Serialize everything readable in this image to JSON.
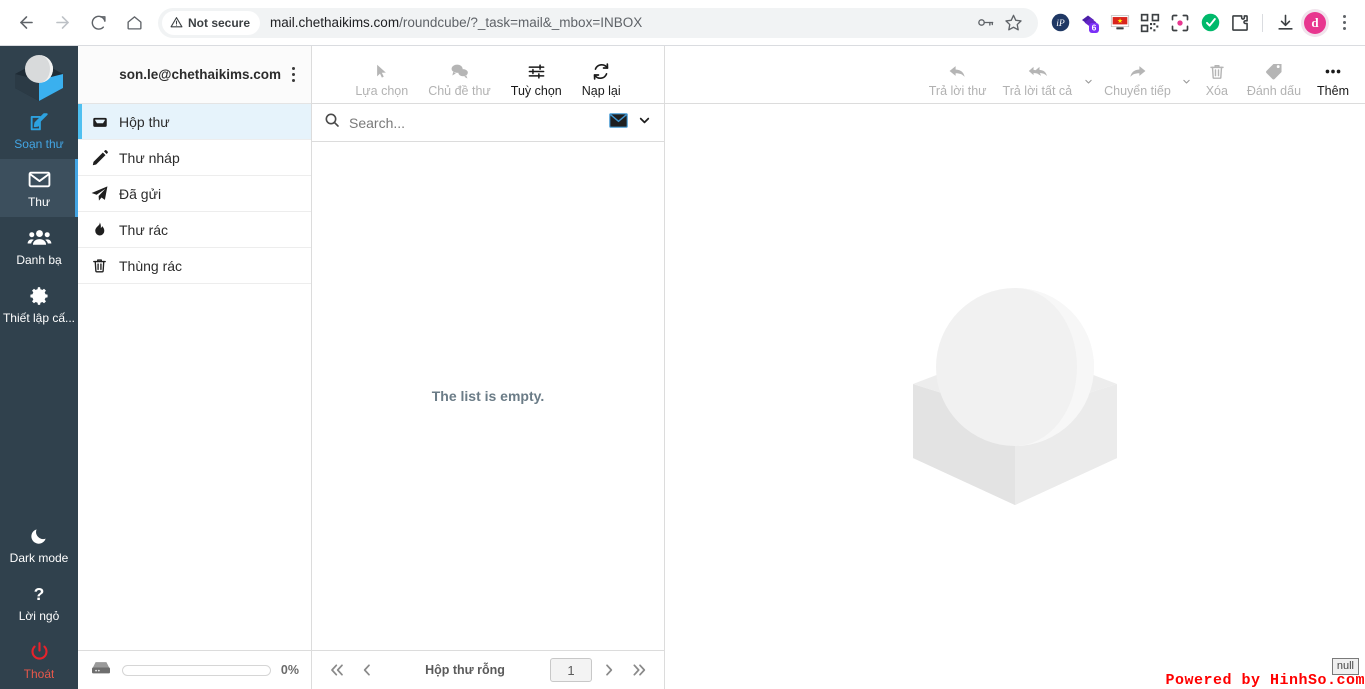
{
  "browser": {
    "back_icon": "arrow-left-icon",
    "forward_icon": "arrow-right-icon",
    "reload_icon": "reload-icon",
    "home_icon": "home-icon",
    "security_label": "Not secure",
    "url_main": "mail.chethaikims.com",
    "url_path": "/roundcube/?_task=mail&_mbox=INBOX",
    "url_full": "mail.chethaikims.com/roundcube/?_task=mail&_mbox=INBOX",
    "password_icon": "key-icon",
    "bookmark_icon": "star-icon",
    "extensions": [
      {
        "name": "ip-extension-icon",
        "badge": "",
        "color": "#1f3864"
      },
      {
        "name": "layers-extension-icon",
        "badge": "6",
        "color": "#6425c7"
      },
      {
        "name": "vietnam-flag-icon",
        "badge": "",
        "color": "#da251d"
      },
      {
        "name": "qr-code-icon",
        "badge": "",
        "color": "#3c4043"
      },
      {
        "name": "screenshot-capture-icon",
        "badge": "",
        "color": "#3c4043"
      },
      {
        "name": "shield-check-icon",
        "badge": "",
        "color": "#00b96b"
      },
      {
        "name": "puzzle-extensions-icon",
        "badge": "",
        "color": "#3c4043"
      }
    ],
    "download_icon": "download-icon",
    "profile_initial": "d",
    "profile_color": "#e8368f",
    "menu_icon": "kebab-menu-icon"
  },
  "rail": {
    "logo_icon": "roundcube-logo-icon",
    "items": [
      {
        "label": "Soạn thư",
        "icon": "compose-icon",
        "state": "accent"
      },
      {
        "label": "Thư",
        "icon": "envelope-icon",
        "state": "selected"
      },
      {
        "label": "Danh bạ",
        "icon": "contacts-icon",
        "state": "normal"
      },
      {
        "label": "Thiết lập cấ...",
        "icon": "gear-icon",
        "state": "normal"
      }
    ],
    "bottom_items": [
      {
        "label": "Dark mode",
        "icon": "moon-icon",
        "state": "normal"
      },
      {
        "label": "Lời ngỏ",
        "icon": "question-icon",
        "state": "normal"
      },
      {
        "label": "Thoát",
        "icon": "power-icon",
        "state": "logout"
      }
    ]
  },
  "folders": {
    "account": "son.le@chethaikims.com",
    "options_icon": "kebab-menu-icon",
    "items": [
      {
        "label": "Hộp thư",
        "icon": "inbox-icon",
        "selected": true
      },
      {
        "label": "Thư nháp",
        "icon": "pencil-icon",
        "selected": false
      },
      {
        "label": "Đã gửi",
        "icon": "paper-plane-icon",
        "selected": false
      },
      {
        "label": "Thư rác",
        "icon": "fire-icon",
        "selected": false
      },
      {
        "label": "Thùng rác",
        "icon": "trash-icon",
        "selected": false
      }
    ],
    "quota_icon": "disk-icon",
    "quota_percent": "0%",
    "quota_value": 0
  },
  "list_toolbar": {
    "buttons": [
      {
        "label": "Lựa chọn",
        "icon": "cursor-select-icon",
        "disabled": true
      },
      {
        "label": "Chủ đề thư",
        "icon": "threads-icon",
        "disabled": true
      },
      {
        "label": "Tuỳ chọn",
        "icon": "sliders-options-icon",
        "disabled": false
      },
      {
        "label": "Nạp lại",
        "icon": "refresh-icon",
        "disabled": false
      }
    ]
  },
  "search": {
    "icon": "search-icon",
    "placeholder": "Search...",
    "value": "",
    "scope_icon": "envelope-icon",
    "dropdown_icon": "chevron-down-icon"
  },
  "message_list": {
    "empty_text": "The list is empty."
  },
  "list_footer": {
    "first_icon": "double-chevron-left-icon",
    "prev_icon": "chevron-left-icon",
    "status": "Hộp thư rỗng",
    "page": "1",
    "next_icon": "chevron-right-icon",
    "last_icon": "double-chevron-right-icon"
  },
  "content_toolbar": {
    "buttons": [
      {
        "label": "Trả lời thư",
        "icon": "reply-icon",
        "disabled": true,
        "caret": false
      },
      {
        "label": "Trả lời tất cả",
        "icon": "reply-all-icon",
        "disabled": true,
        "caret": true
      },
      {
        "label": "Chuyển tiếp",
        "icon": "forward-icon",
        "disabled": true,
        "caret": true
      },
      {
        "label": "Xóa",
        "icon": "trash-icon",
        "disabled": true,
        "caret": false
      },
      {
        "label": "Đánh dấu",
        "icon": "tag-icon",
        "disabled": true,
        "caret": false
      },
      {
        "label": "Thêm",
        "icon": "ellipsis-icon",
        "disabled": false,
        "caret": false
      }
    ]
  },
  "content": {
    "watermark_icon": "roundcube-watermark-icon",
    "powered_by": "Powered by HinhSo.com",
    "tooltip": "null"
  },
  "colors": {
    "rail_bg": "#30414d",
    "rail_selected": "#3c4f5d",
    "accent": "#43a5e4",
    "folder_selected_bg": "#e6f3fb",
    "folder_selected_border": "#4fc0f0",
    "logout_red": "#e8222b",
    "powered_red": "#ff0000"
  }
}
